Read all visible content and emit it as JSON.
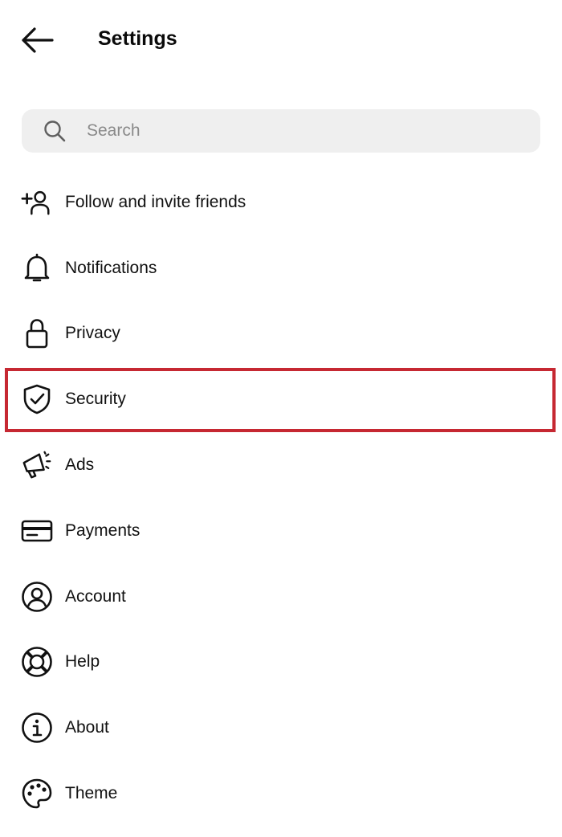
{
  "header": {
    "back_icon": "arrow-left-icon",
    "title": "Settings"
  },
  "search": {
    "icon": "search-icon",
    "placeholder": "Search",
    "value": ""
  },
  "menu": {
    "items": [
      {
        "label": "Follow and invite friends",
        "icon": "add-person-icon"
      },
      {
        "label": "Notifications",
        "icon": "bell-icon"
      },
      {
        "label": "Privacy",
        "icon": "lock-icon"
      },
      {
        "label": "Security",
        "icon": "shield-check-icon",
        "highlighted": true
      },
      {
        "label": "Ads",
        "icon": "megaphone-icon"
      },
      {
        "label": "Payments",
        "icon": "credit-card-icon"
      },
      {
        "label": "Account",
        "icon": "user-circle-icon"
      },
      {
        "label": "Help",
        "icon": "lifebuoy-icon"
      },
      {
        "label": "About",
        "icon": "info-icon"
      },
      {
        "label": "Theme",
        "icon": "palette-icon"
      }
    ]
  },
  "colors": {
    "highlight_border": "#c62832",
    "search_bg": "#efefef",
    "text": "#111111"
  }
}
